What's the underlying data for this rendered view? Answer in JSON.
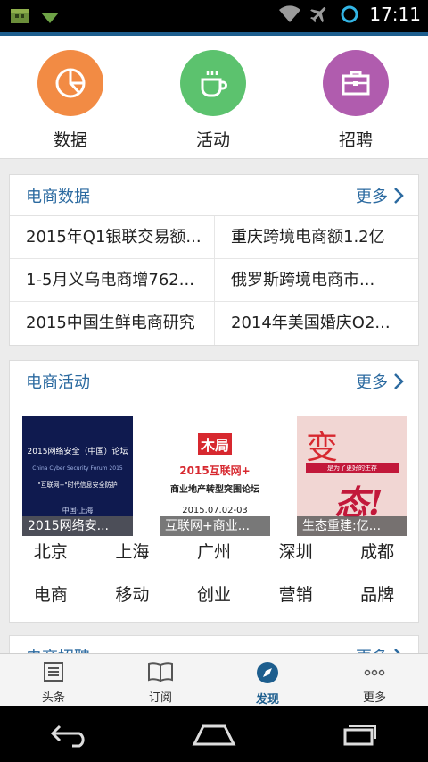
{
  "status_bar": {
    "time": "17:11",
    "icons": [
      "app-icon",
      "download-icon",
      "wifi-icon",
      "airplane-icon",
      "loading-icon"
    ]
  },
  "quick_entries": [
    {
      "label": "数据",
      "icon": "pie-chart-icon",
      "color": "#f28b44"
    },
    {
      "label": "活动",
      "icon": "coffee-cup-icon",
      "color": "#5cc26e"
    },
    {
      "label": "招聘",
      "icon": "briefcase-icon",
      "color": "#b05cae"
    }
  ],
  "data_card": {
    "title": "电商数据",
    "more": "更多",
    "items": [
      "2015年Q1银联交易额...",
      "重庆跨境电商额1.2亿",
      "1-5月义乌电商增762...",
      "俄罗斯跨境电商市...",
      "2015中国生鲜电商研究",
      "2014年美国婚庆O2..."
    ]
  },
  "events_card": {
    "title": "电商活动",
    "more": "更多",
    "events": [
      {
        "caption": "2015网络安...",
        "poster_title": "2015网络安全（中国）论坛",
        "poster_sub": "China Cyber Security Forum 2015",
        "poster_line": "\"互联网+\"时代信息安全防护",
        "poster_place": "中国·上海"
      },
      {
        "caption": "互联网+商业...",
        "poster_logo": "木局",
        "poster_title": "2015互联网+",
        "poster_sub": "商业地产转型突围论坛",
        "poster_date": "2015.07.02-03"
      },
      {
        "caption": "生态重建:亿...",
        "poster_big": "变",
        "poster_sub": "是为了更好的生存",
        "poster_script": "态!"
      }
    ],
    "tags": [
      "北京",
      "上海",
      "广州",
      "深圳",
      "成都",
      "电商",
      "移动",
      "创业",
      "营销",
      "品牌"
    ]
  },
  "jobs_card": {
    "title": "电商招聘",
    "more": "更多"
  },
  "bottom_nav": [
    {
      "label": "头条",
      "icon": "news-icon",
      "active": false
    },
    {
      "label": "订阅",
      "icon": "book-icon",
      "active": false
    },
    {
      "label": "发现",
      "icon": "compass-icon",
      "active": true
    },
    {
      "label": "更多",
      "icon": "more-dots-icon",
      "active": false
    }
  ],
  "colors": {
    "accent": "#1d5e8e",
    "link": "#2b6aa0"
  }
}
